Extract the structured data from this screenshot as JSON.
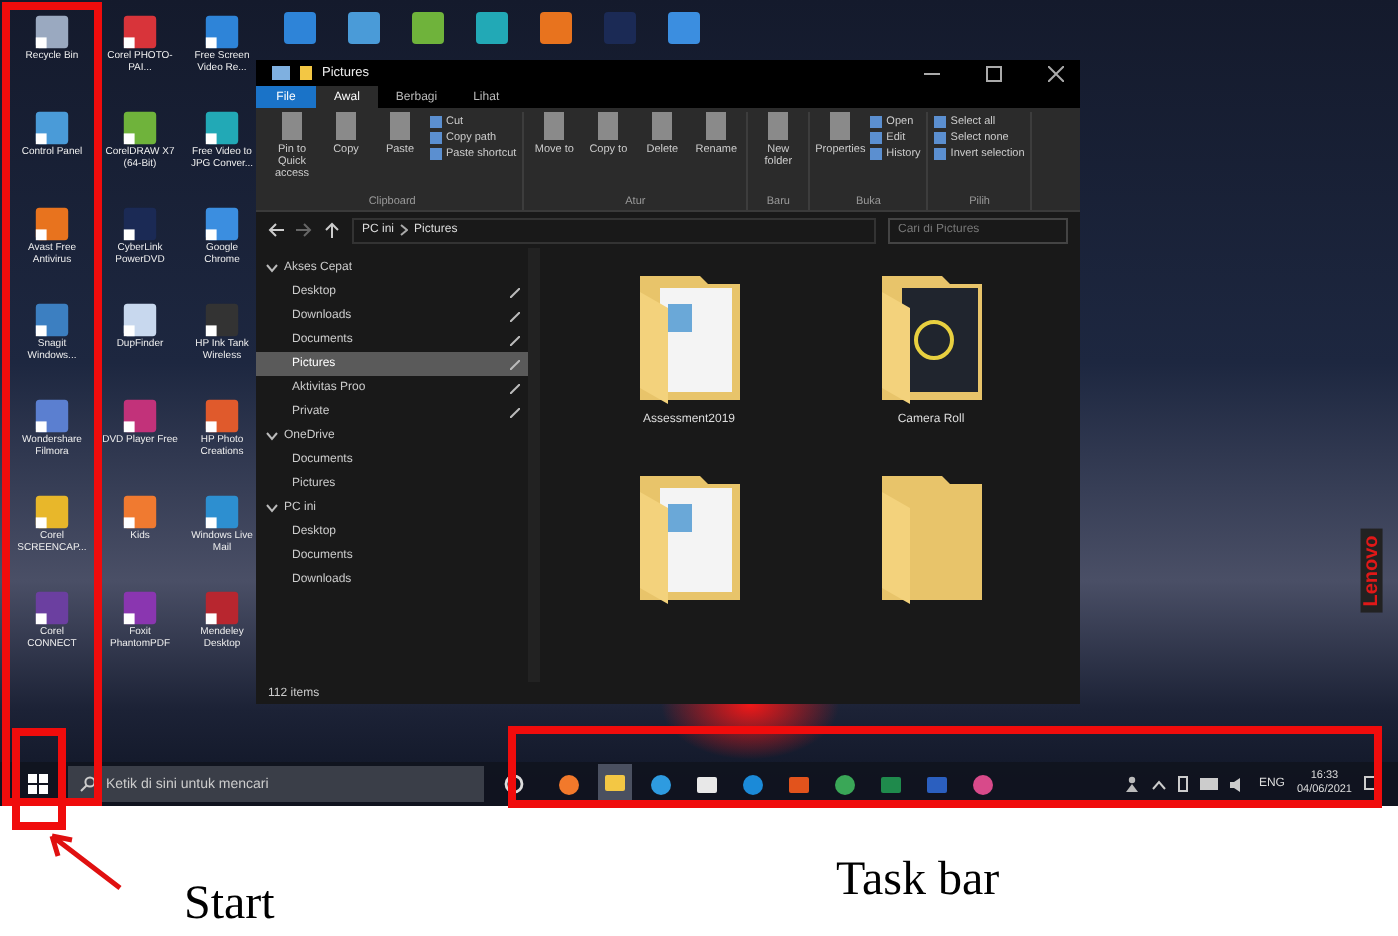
{
  "desktop": {
    "icons": [
      {
        "label": "Recycle Bin"
      },
      {
        "label": "Corel PHOTO-PAI..."
      },
      {
        "label": "Free Screen Video Re..."
      },
      {
        "label": "Control Panel"
      },
      {
        "label": "CorelDRAW X7 (64-Bit)"
      },
      {
        "label": "Free Video to JPG Conver..."
      },
      {
        "label": "Avast Free Antivirus"
      },
      {
        "label": "CyberLink PowerDVD"
      },
      {
        "label": "Google Chrome"
      },
      {
        "label": "Snagit Windows..."
      },
      {
        "label": "DupFinder"
      },
      {
        "label": "HP Ink Tank Wireless"
      },
      {
        "label": "Wondershare Filmora"
      },
      {
        "label": "DVD Player Free"
      },
      {
        "label": "HP Photo Creations"
      },
      {
        "label": "Corel SCREENCAP..."
      },
      {
        "label": "Kids"
      },
      {
        "label": "Windows Live Mail"
      },
      {
        "label": "Corel CONNECT"
      },
      {
        "label": "Foxit PhantomPDF"
      },
      {
        "label": "Mendeley Desktop"
      }
    ]
  },
  "bezel_logo": "Lenovo",
  "explorer": {
    "title": "Pictures",
    "file_tab": "File",
    "tabs": [
      {
        "label": "Awal",
        "selected": true
      },
      {
        "label": "Berbagi",
        "selected": false
      },
      {
        "label": "Lihat",
        "selected": false
      }
    ],
    "ribbon": [
      {
        "label": "Clipboard",
        "items": [
          {
            "label": "Pin to Quick access",
            "kind": "large"
          },
          {
            "label": "Copy",
            "kind": "large"
          },
          {
            "label": "Paste",
            "kind": "large"
          },
          {
            "label": "Cut",
            "kind": "small"
          },
          {
            "label": "Copy path",
            "kind": "small"
          },
          {
            "label": "Paste shortcut",
            "kind": "small"
          }
        ]
      },
      {
        "label": "Atur",
        "items": [
          {
            "label": "Move to",
            "kind": "large"
          },
          {
            "label": "Copy to",
            "kind": "large"
          },
          {
            "label": "Delete",
            "kind": "large"
          },
          {
            "label": "Rename",
            "kind": "large"
          }
        ]
      },
      {
        "label": "Baru",
        "items": [
          {
            "label": "New folder",
            "kind": "large"
          }
        ]
      },
      {
        "label": "Buka",
        "items": [
          {
            "label": "Properties",
            "kind": "large"
          },
          {
            "label": "Open",
            "kind": "small"
          },
          {
            "label": "Edit",
            "kind": "small"
          },
          {
            "label": "History",
            "kind": "small"
          }
        ]
      },
      {
        "label": "Pilih",
        "items": [
          {
            "label": "Select all",
            "kind": "small"
          },
          {
            "label": "Select none",
            "kind": "small"
          },
          {
            "label": "Invert selection",
            "kind": "small"
          }
        ]
      }
    ],
    "address": [
      "PC ini",
      "Pictures"
    ],
    "search": {
      "placeholder": "Cari di Pictures"
    },
    "nav": [
      {
        "label": "Akses Cepat",
        "expanded": true,
        "children": [
          {
            "label": "Desktop",
            "pinned": true,
            "selected": false
          },
          {
            "label": "Downloads",
            "pinned": true,
            "selected": false
          },
          {
            "label": "Documents",
            "pinned": true,
            "selected": false
          },
          {
            "label": "Pictures",
            "pinned": true,
            "selected": true
          },
          {
            "label": "Aktivitas Proo",
            "pinned": true,
            "selected": false
          },
          {
            "label": "Private",
            "pinned": true,
            "selected": false
          }
        ]
      },
      {
        "label": "OneDrive",
        "expanded": true,
        "children": [
          {
            "label": "Documents",
            "pinned": false,
            "selected": false
          },
          {
            "label": "Pictures",
            "pinned": false,
            "selected": false
          }
        ]
      },
      {
        "label": "PC ini",
        "expanded": true,
        "children": [
          {
            "label": "Desktop",
            "pinned": false,
            "selected": false
          },
          {
            "label": "Documents",
            "pinned": false,
            "selected": false
          },
          {
            "label": "Downloads",
            "pinned": false,
            "selected": false
          }
        ]
      }
    ],
    "folders": [
      {
        "name": "Assessment2019",
        "kind": "documents"
      },
      {
        "name": "Camera Roll",
        "kind": "camera"
      },
      {
        "kind": "documents"
      },
      {
        "kind": "empty"
      }
    ],
    "status": "112 items"
  },
  "taskbar": {
    "search": {
      "placeholder": "Ketik di sini untuk mencari"
    },
    "apps": [
      {
        "kind": "firefox",
        "active": false
      },
      {
        "kind": "explorer",
        "active": true
      },
      {
        "kind": "ie",
        "active": false
      },
      {
        "kind": "camera",
        "active": false
      },
      {
        "kind": "edge",
        "active": false
      },
      {
        "kind": "office",
        "active": false
      },
      {
        "kind": "chrome",
        "active": false
      },
      {
        "kind": "excel",
        "active": false
      },
      {
        "kind": "word",
        "active": false
      },
      {
        "kind": "paint",
        "active": false
      }
    ],
    "language": "ENG",
    "time": "16:33",
    "date": "04/06/2021"
  },
  "annotations": [
    {
      "label": "Start"
    },
    {
      "label": "Task bar"
    }
  ]
}
